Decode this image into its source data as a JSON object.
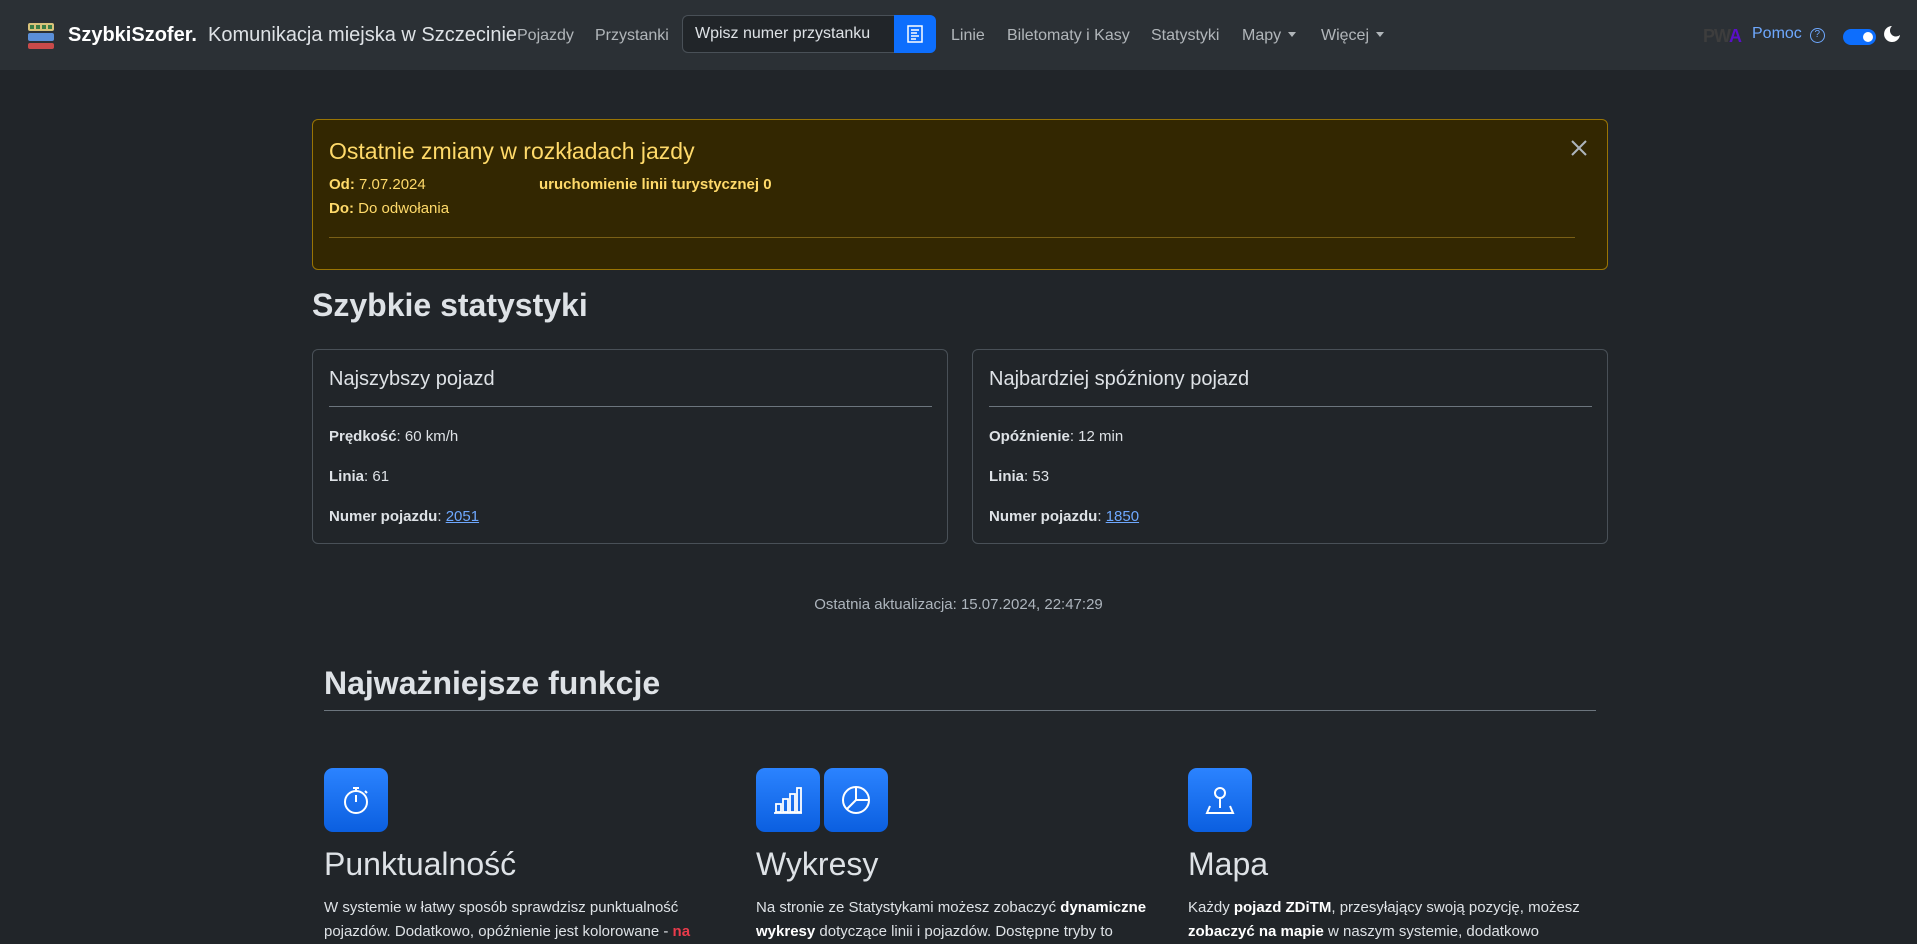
{
  "navbar": {
    "brand_name": "SzybkiSzofer.",
    "brand_subtitle": "Komunikacja miejska w Szczecinie",
    "links": {
      "vehicles": "Pojazdy",
      "stops": "Przystanki",
      "lines": "Linie",
      "ticket_machines": "Biletomaty i Kasy",
      "statistics": "Statystyki",
      "maps": "Mapy",
      "more": "Więcej"
    },
    "search_placeholder": "Wpisz numer przystanku",
    "pwa_p": "PW",
    "pwa_a": "A",
    "help": "Pomoc",
    "help_icon_glyph": "?"
  },
  "alert": {
    "title": "Ostatnie zmiany w rozkładach jazdy",
    "from_label": "Od:",
    "from_value": "7.07.2024",
    "to_label": "Do:",
    "to_value": "Do odwołania",
    "description": "uruchomienie linii turystycznej 0"
  },
  "stats": {
    "section_title": "Szybkie statystyki",
    "fastest": {
      "title": "Najszybszy pojazd",
      "speed_label": "Prędkość",
      "speed_value": ": 60 km/h",
      "line_label": "Linia",
      "line_value": ": 61",
      "vehicle_label": "Numer pojazdu",
      "vehicle_sep": ": ",
      "vehicle_value": "2051"
    },
    "most_delayed": {
      "title": "Najbardziej spóźniony pojazd",
      "delay_label": "Opóźnienie",
      "delay_value": ": 12 min",
      "line_label": "Linia",
      "line_value": ": 53",
      "vehicle_label": "Numer pojazdu",
      "vehicle_sep": ": ",
      "vehicle_value": "1850"
    },
    "last_update": "Ostatnia aktualizacja: 15.07.2024, 22:47:29"
  },
  "features": {
    "title": "Najważniejsze funkcje",
    "punctuality": {
      "heading": "Punktualność",
      "text_1": "W systemie w łatwy sposób sprawdzisz punktualność pojazdów. Dodatkowo, opóźnienie jest kolorowane - ",
      "text_red": "na"
    },
    "charts": {
      "heading": "Wykresy",
      "text_1": "Na stronie ze Statystykami możesz zobaczyć ",
      "text_bold": "dynamiczne wykresy",
      "text_2": " dotyczące linii i pojazdów. Dostępne tryby to"
    },
    "map": {
      "heading": "Mapa",
      "text_1": "Każdy ",
      "text_bold_1": "pojazd ZDiTM",
      "text_2": ", przesyłający swoją pozycję, możesz ",
      "text_bold_2": "zobaczyć na mapie",
      "text_3": " w naszym systemie, dodatkowo"
    }
  },
  "colors": {
    "accent": "#0d6efd",
    "background": "#212529",
    "navbar": "#2b3035",
    "alert_bg": "#332701",
    "alert_text": "#ffda6a"
  },
  "icons": [
    "app-logo-icon",
    "search-icon",
    "help-icon",
    "theme-toggle",
    "moon-icon",
    "close-icon",
    "stopwatch-icon",
    "bar-chart-icon",
    "pie-chart-icon",
    "map-pin-icon"
  ]
}
